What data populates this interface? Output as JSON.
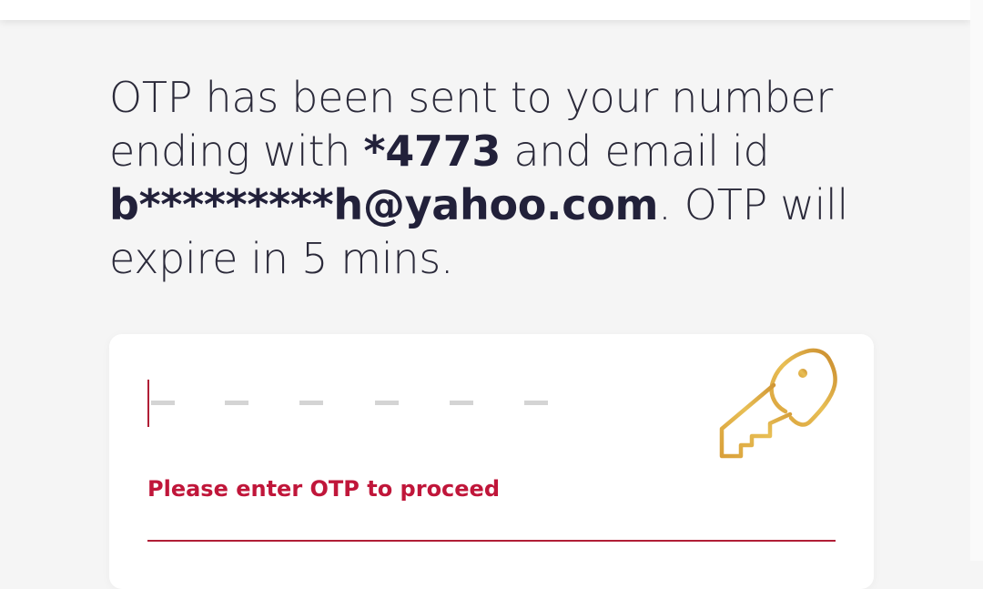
{
  "message": {
    "line_prefix": "OTP has been sent to your number ending with ",
    "phone_suffix": "*4773",
    "mid_text": " and email id ",
    "email": "b*********h@yahoo.com",
    "suffix": ". OTP will expire in 5 mins."
  },
  "otp": {
    "value": "",
    "slots": 6
  },
  "error_message": "Please enter OTP to proceed",
  "colors": {
    "background": "#f5f5f5",
    "text": "#2b2a3a",
    "error": "#c0163a",
    "accent_line": "#b01e36",
    "key_gold_light": "#e3b64a",
    "key_gold_dark": "#c98a2c"
  },
  "icons": {
    "key": "key-icon"
  }
}
